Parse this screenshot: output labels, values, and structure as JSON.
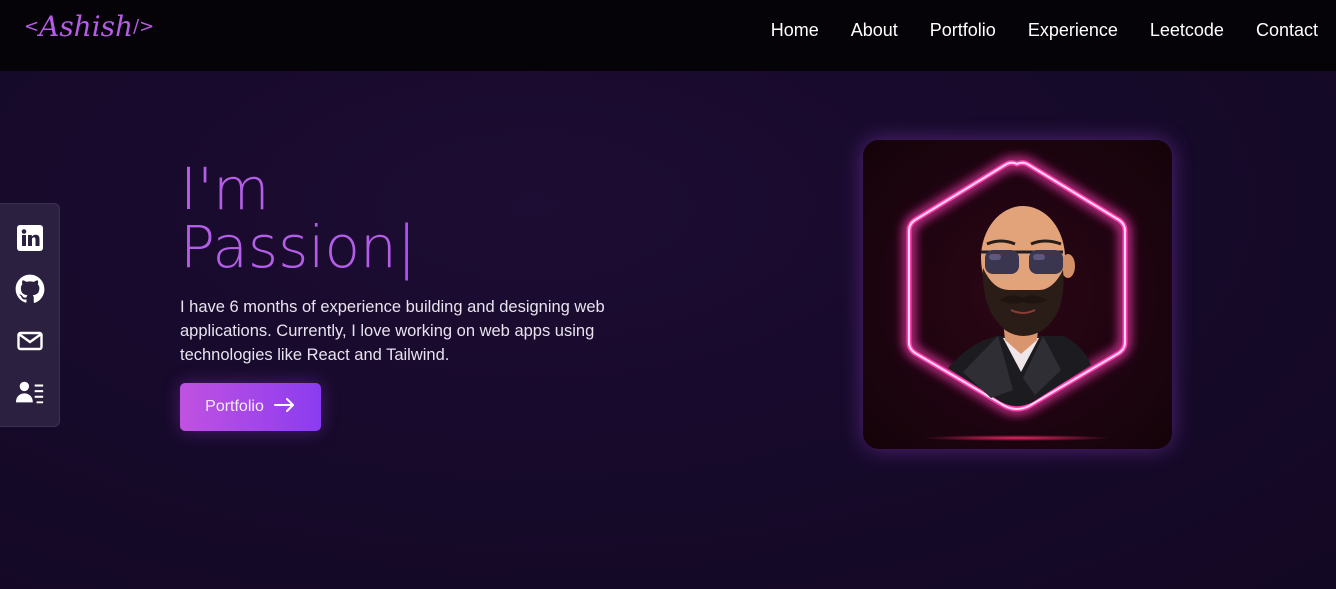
{
  "navbar": {
    "logo_text": "Ashish",
    "logo_open": "<",
    "logo_close": "/>",
    "links": [
      "Home",
      "About",
      "Portfolio",
      "Experience",
      "Leetcode",
      "Contact"
    ]
  },
  "social": {
    "icons": [
      "linkedin-icon",
      "github-icon",
      "mail-icon",
      "resume-icon"
    ]
  },
  "hero": {
    "title_line1": "I'm",
    "title_line2": "Passion",
    "cursor": "|",
    "description": "I have 6 months of experience building and designing web applications. Currently, I love working on web apps using technologies like React and Tailwind.",
    "cta_label": "Portfolio",
    "cta_icon": "arrow-right-icon"
  },
  "colors": {
    "accent": "#b45ee8",
    "nav_bg": "#050307",
    "page_bg": "#170a2b",
    "neon": "#ff3fb4"
  }
}
